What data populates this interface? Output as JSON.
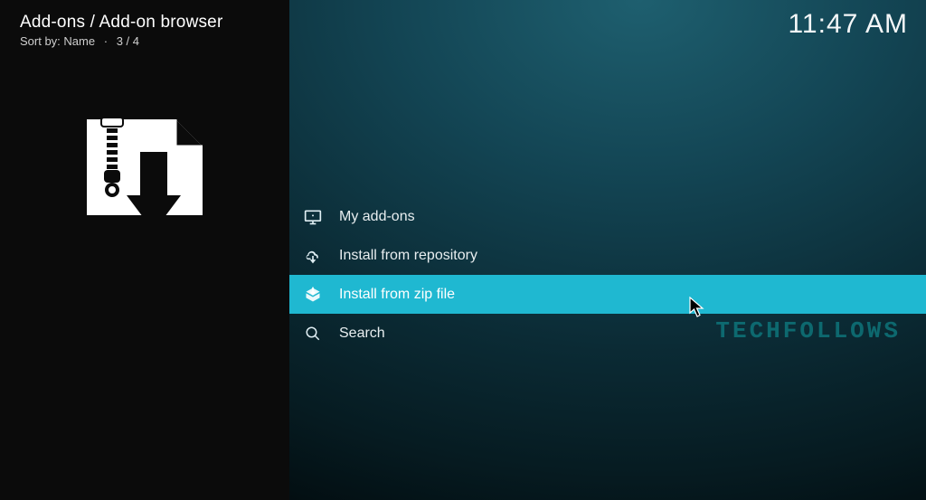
{
  "header": {
    "breadcrumb": "Add-ons / Add-on browser",
    "sort_label": "Sort by:",
    "sort_value": "Name",
    "index": "3 / 4"
  },
  "clock": "11:47 AM",
  "menu": {
    "items": [
      {
        "id": "my-addons",
        "label": "My add-ons",
        "icon": "monitor",
        "selected": false
      },
      {
        "id": "install-repo",
        "label": "Install from repository",
        "icon": "cloud-down",
        "selected": false
      },
      {
        "id": "install-zip",
        "label": "Install from zip file",
        "icon": "box-down",
        "selected": true
      },
      {
        "id": "search",
        "label": "Search",
        "icon": "search",
        "selected": false
      }
    ]
  },
  "watermark": "TECHFOLLOWS"
}
